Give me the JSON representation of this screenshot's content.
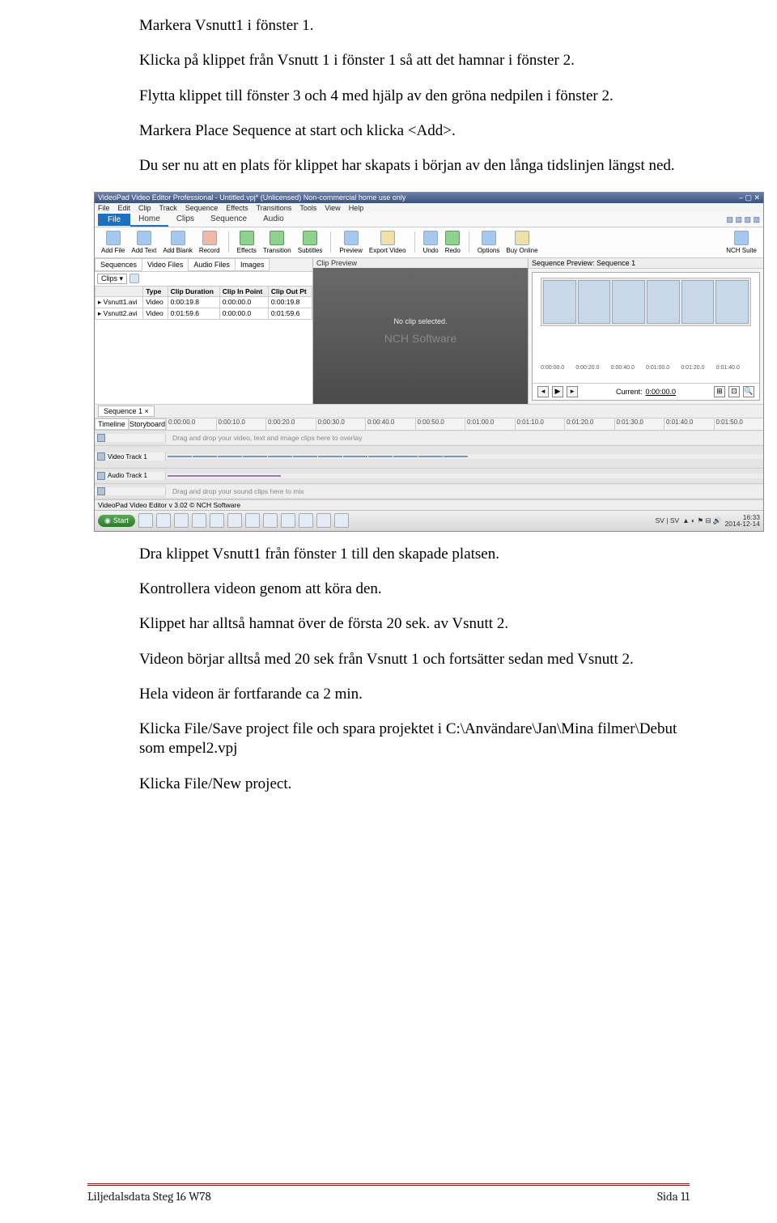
{
  "paragraphs": {
    "p1": "Markera Vsnutt1 i fönster 1.",
    "p2": "Klicka på klippet från Vsnutt 1 i fönster 1 så att det hamnar i fönster 2.",
    "p3": "Flytta klippet till fönster 3 och 4 med hjälp av den gröna nedpilen i fönster 2.",
    "p4": "Markera Place Sequence at start och klicka <Add>.",
    "p5": "Du ser nu att en plats för klippet har skapats i början av den långa tidslinjen längst ned.",
    "p6": "Dra klippet Vsnutt1 från fönster 1 till den skapade platsen.",
    "p7": "Kontrollera videon genom att köra den.",
    "p8": "Klippet har alltså hamnat över de första 20 sek. av Vsnutt 2.",
    "p9": "Videon börjar alltså med 20 sek från Vsnutt 1 och fortsätter sedan med Vsnutt 2.",
    "p10": "Hela videon är fortfarande ca 2 min.",
    "p11": "Klicka File/Save project file och spara projektet i C:\\Användare\\Jan\\Mina filmer\\Debut som empel2.vpj",
    "p12": "Klicka File/New project."
  },
  "app": {
    "title": "VideoPad Video Editor Professional - Untitled.vpj* (Unlicensed) Non-commercial home use only",
    "menus": [
      "File",
      "Edit",
      "Clip",
      "Track",
      "Sequence",
      "Effects",
      "Transitions",
      "Tools",
      "View",
      "Help"
    ],
    "ribbon": {
      "file": "File",
      "tabs": [
        "Home",
        "Clips",
        "Sequence",
        "Audio"
      ]
    },
    "toolbar": [
      {
        "l": "Add File",
        "c": "b"
      },
      {
        "l": "Add Text",
        "c": "b"
      },
      {
        "l": "Add Blank",
        "c": "b"
      },
      {
        "l": "Record",
        "c": "r"
      },
      {
        "sep": true
      },
      {
        "l": "Effects",
        "c": "g"
      },
      {
        "l": "Transition",
        "c": "g"
      },
      {
        "l": "Subtitles",
        "c": "g"
      },
      {
        "sep": true
      },
      {
        "l": "Preview",
        "c": "b"
      },
      {
        "l": "Export Video",
        "c": "y"
      },
      {
        "sep": true
      },
      {
        "l": "Undo",
        "c": "b"
      },
      {
        "l": "Redo",
        "c": "g"
      },
      {
        "sep": true
      },
      {
        "l": "Options",
        "c": "b"
      },
      {
        "l": "Buy Online",
        "c": "y"
      }
    ],
    "nchsuite": "NCH Suite",
    "leftpane": {
      "subtabs": [
        "Sequences",
        "Video Files",
        "Audio Files",
        "Images"
      ],
      "active": 1,
      "dropdown": "Clips",
      "columns": [
        "Type",
        "Clip Duration",
        "Clip In Point",
        "Clip Out Pt"
      ],
      "rows": [
        {
          "name": "Vsnutt1.avi",
          "type": "Video",
          "dur": "0:00:19.8",
          "in": "0:00:00.0",
          "out": "0:00:19.8"
        },
        {
          "name": "Vsnutt2.avi",
          "type": "Video",
          "dur": "0:01:59.6",
          "in": "0:00:00.0",
          "out": "0:01:59.6"
        }
      ]
    },
    "center": {
      "header": "Clip Preview",
      "msg": "No clip selected.",
      "watermark": "NCH Software"
    },
    "right": {
      "header": "Sequence Preview: Sequence 1",
      "ruler": [
        "0:00:00.0",
        "0:00:20.0",
        "0:00:40.0",
        "0:01:00.0",
        "0:01:20.0",
        "0:01:40.0"
      ],
      "current_label": "Current:",
      "current": "0:00:00.0"
    },
    "sequence_tab": "Sequence 1 ×",
    "timeline": {
      "sidetabs": [
        "Timeline",
        "Storyboard"
      ],
      "ruler": [
        "0:00:00.0",
        "0:00:10.0",
        "0:00:20.0",
        "0:00:30.0",
        "0:00:40.0",
        "0:00:50.0",
        "0:01:00.0",
        "0:01:10.0",
        "0:01:20.0",
        "0:01:30.0",
        "0:01:40.0",
        "0:01:50.0"
      ],
      "overlay_hint": "Drag and drop your video, text and image clips here to overlay",
      "video_label": "Video Track 1",
      "audio_label": "Audio Track 1",
      "sound_hint": "Drag and drop your sound clips here to mix"
    },
    "statusbar": "VideoPad Video Editor v 3.02 © NCH Software",
    "taskbar": {
      "start": "Start",
      "tray_lang": "SV | SV",
      "time": "16:33",
      "date": "2014-12-14"
    }
  },
  "footer": {
    "left": "Liljedalsdata Steg 16 W78",
    "right": "Sida 11"
  }
}
